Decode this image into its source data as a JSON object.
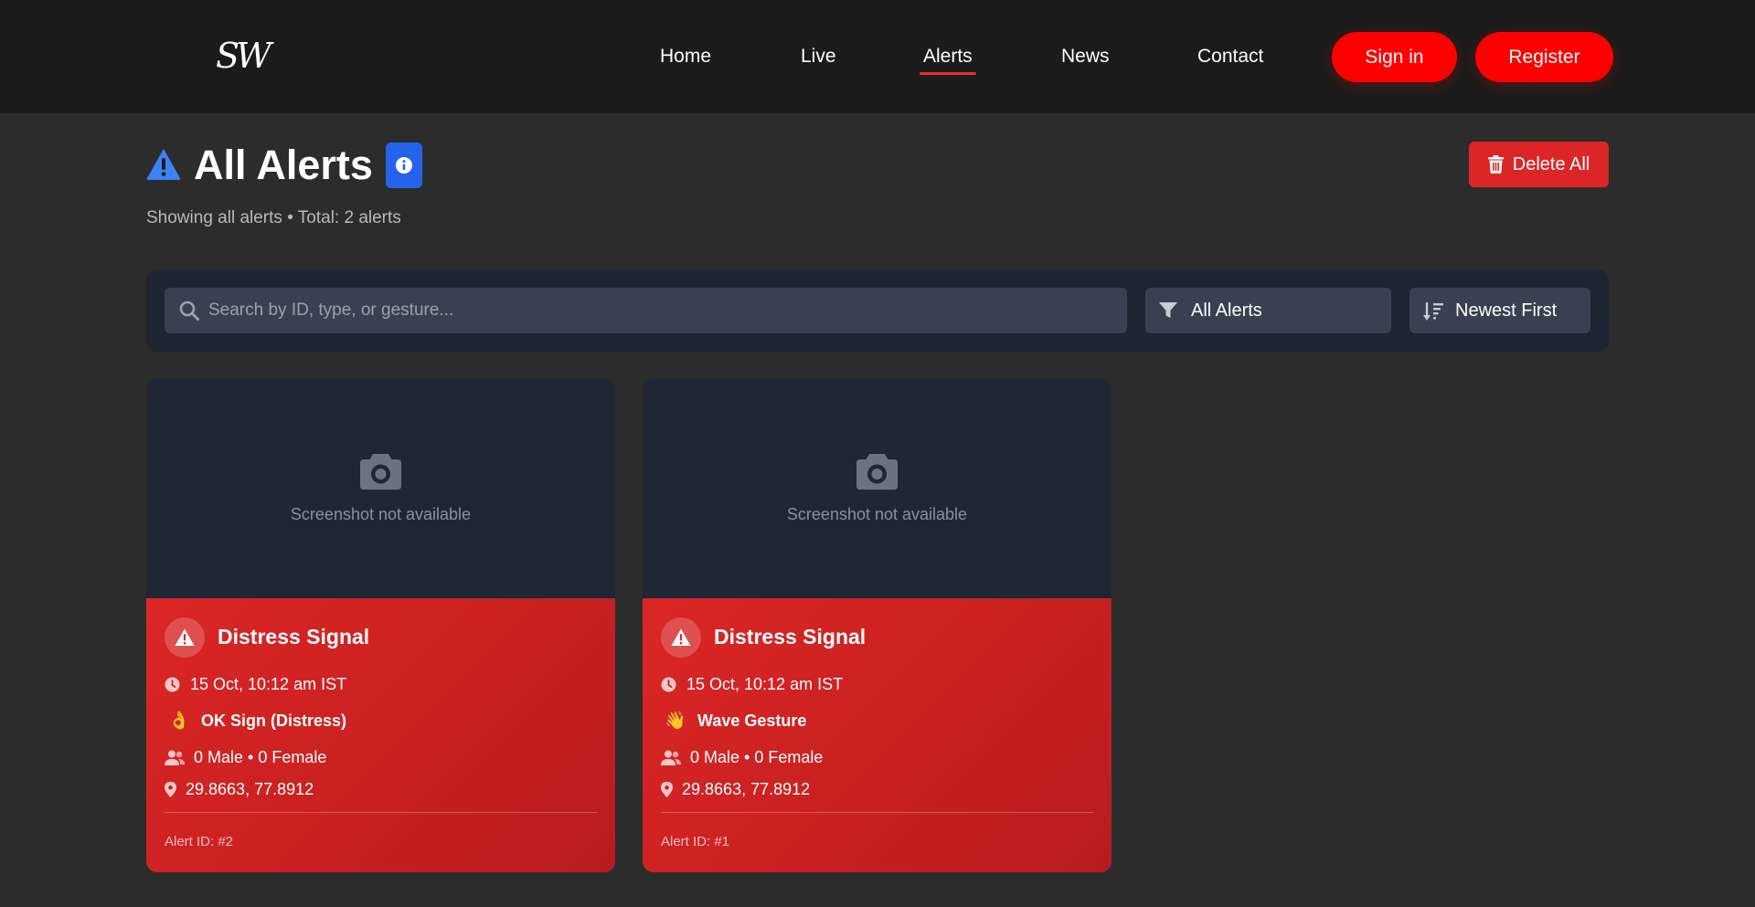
{
  "nav": {
    "logo": "SW",
    "links": [
      "Home",
      "Live",
      "Alerts",
      "News",
      "Contact"
    ],
    "active": "Alerts",
    "sign_in": "Sign in",
    "register": "Register"
  },
  "page": {
    "title": "All Alerts",
    "subtitle": "Showing all alerts • Total: 2 alerts",
    "delete_all": "Delete All"
  },
  "filters": {
    "search_placeholder": "Search by ID, type, or gesture...",
    "search_value": "",
    "type_selected": "All Alerts",
    "sort_selected": "Newest First"
  },
  "alerts": [
    {
      "screenshot_text": "Screenshot not available",
      "title": "Distress Signal",
      "time": "15 Oct, 10:12 am IST",
      "gesture_emoji": "👌",
      "gesture": "OK Sign (Distress)",
      "people": "0 Male • 0 Female",
      "location": "29.8663, 77.8912",
      "id": "Alert ID: #2"
    },
    {
      "screenshot_text": "Screenshot not available",
      "title": "Distress Signal",
      "time": "15 Oct, 10:12 am IST",
      "gesture_emoji": "👋",
      "gesture": "Wave Gesture",
      "people": "0 Male • 0 Female",
      "location": "29.8663, 77.8912",
      "id": "Alert ID: #1"
    }
  ],
  "icons": {
    "title": "warning-triangle-icon",
    "info": "info-icon",
    "delete": "trash-icon",
    "search": "search-icon",
    "filter": "filter-icon",
    "sort": "sort-icon",
    "camera": "camera-icon",
    "time": "clock-icon",
    "people": "users-icon",
    "location": "map-pin-icon"
  },
  "colors": {
    "header_bg": "#1b1b1b",
    "page_bg": "#2c2c2c",
    "accent_red": "#ff0000",
    "alert_card_red": "#dc2626",
    "info_blue": "#2563eb",
    "panel_bg": "#1e2533"
  }
}
